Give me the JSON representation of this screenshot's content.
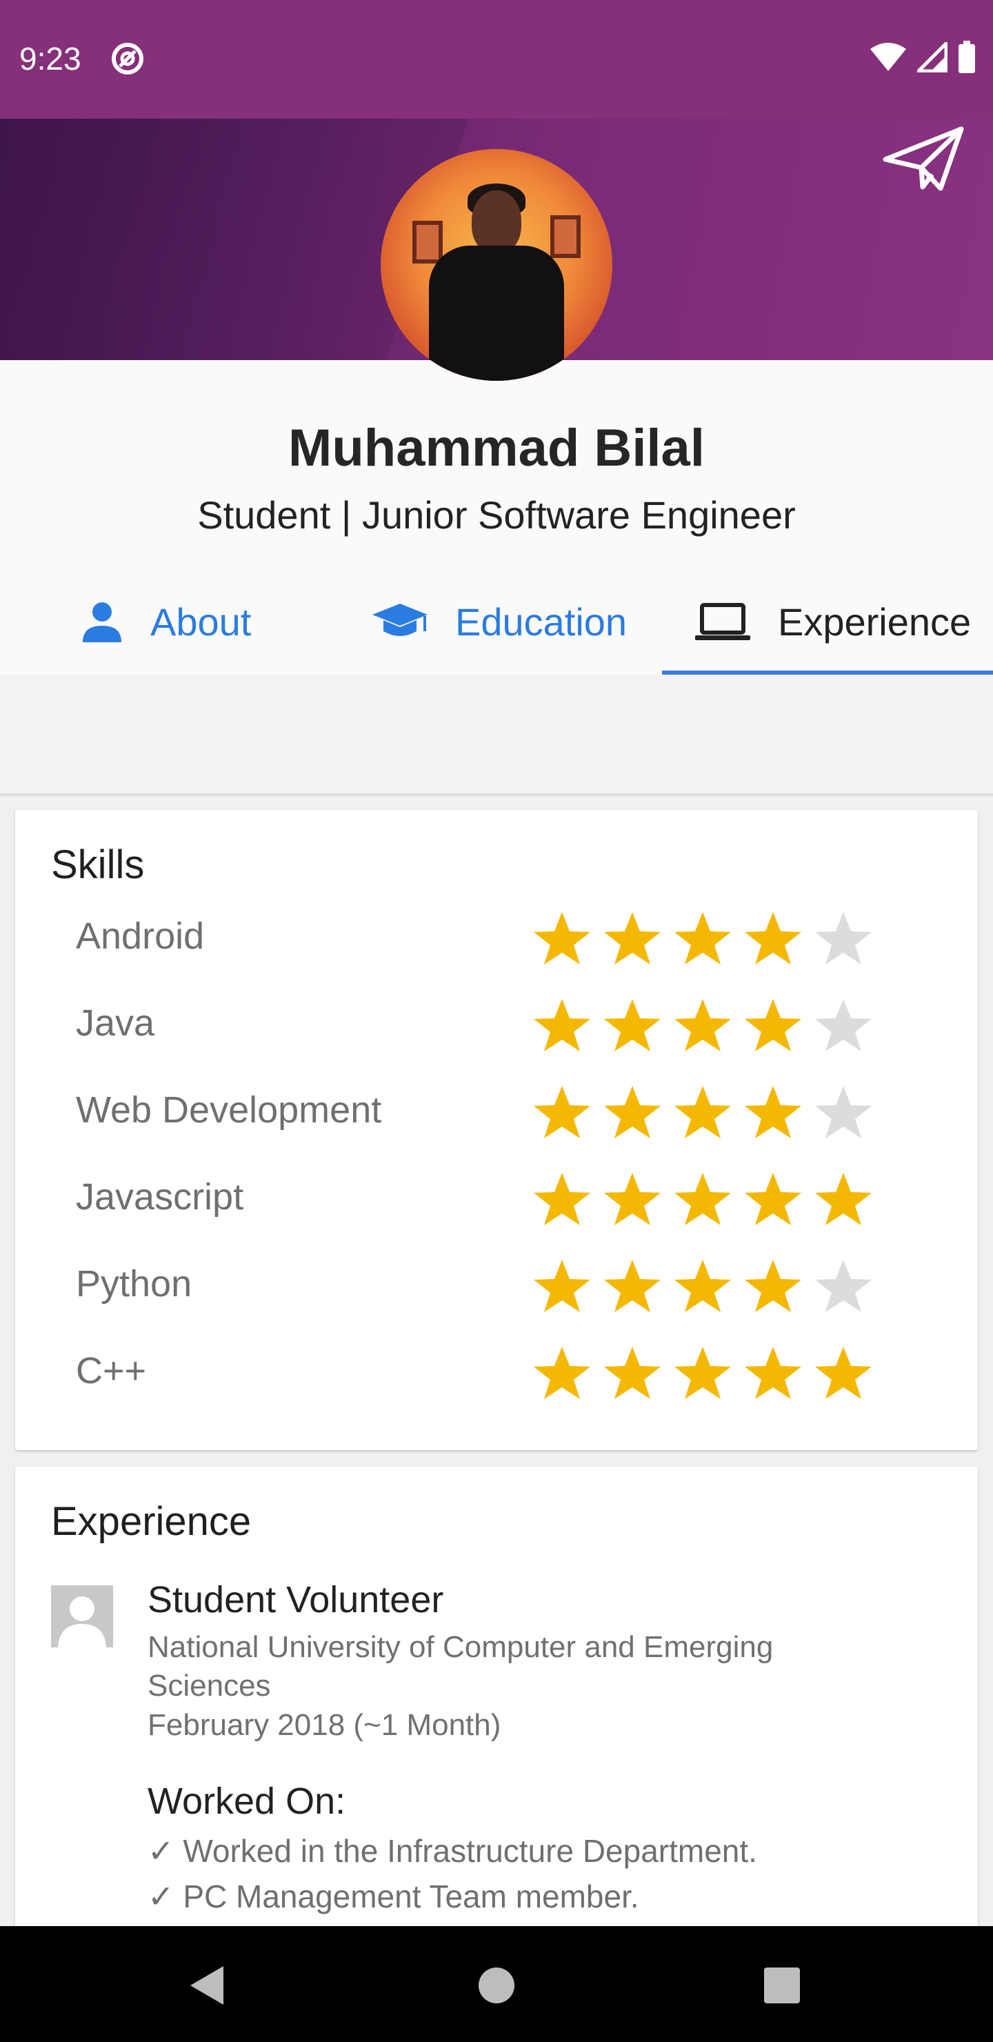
{
  "status_bar": {
    "time": "9:23",
    "icons": [
      "at-sign-icon",
      "wifi-icon",
      "signal-icon",
      "battery-icon"
    ]
  },
  "header": {
    "send_icon": "paper-plane-icon",
    "colors": {
      "banner_start": "#4a1b57",
      "banner_end": "#8a3282",
      "status_bar": "#862f7b"
    }
  },
  "profile": {
    "name": "Muhammad Bilal",
    "title": "Student | Junior Software Engineer"
  },
  "tabs": [
    {
      "label": "About",
      "icon": "person-icon",
      "active": false
    },
    {
      "label": "Education",
      "icon": "graduation-cap-icon",
      "active": false
    },
    {
      "label": "Experience",
      "icon": "laptop-icon",
      "active": true
    }
  ],
  "skills": {
    "title": "Skills",
    "max_rating": 5,
    "items": [
      {
        "name": "Android",
        "rating": 4
      },
      {
        "name": "Java",
        "rating": 4
      },
      {
        "name": "Web Development",
        "rating": 4
      },
      {
        "name": "Javascript",
        "rating": 5
      },
      {
        "name": "Python",
        "rating": 4
      },
      {
        "name": "C++",
        "rating": 5
      }
    ],
    "colors": {
      "star_filled": "#f5b800",
      "star_empty": "#dcdcdc"
    }
  },
  "experience": {
    "title": "Experience",
    "items": [
      {
        "role": "Student Volunteer",
        "organization": "National University of Computer and Emerging Sciences",
        "date": "February 2018 (~1 Month)",
        "worked_on_label": "Worked On:",
        "bullets": [
          "✓ Worked in the Infrastructure Department.",
          "✓ PC Management Team member."
        ]
      }
    ]
  },
  "nav_bar": {
    "buttons": [
      "back-icon",
      "home-icon",
      "recents-icon"
    ]
  }
}
